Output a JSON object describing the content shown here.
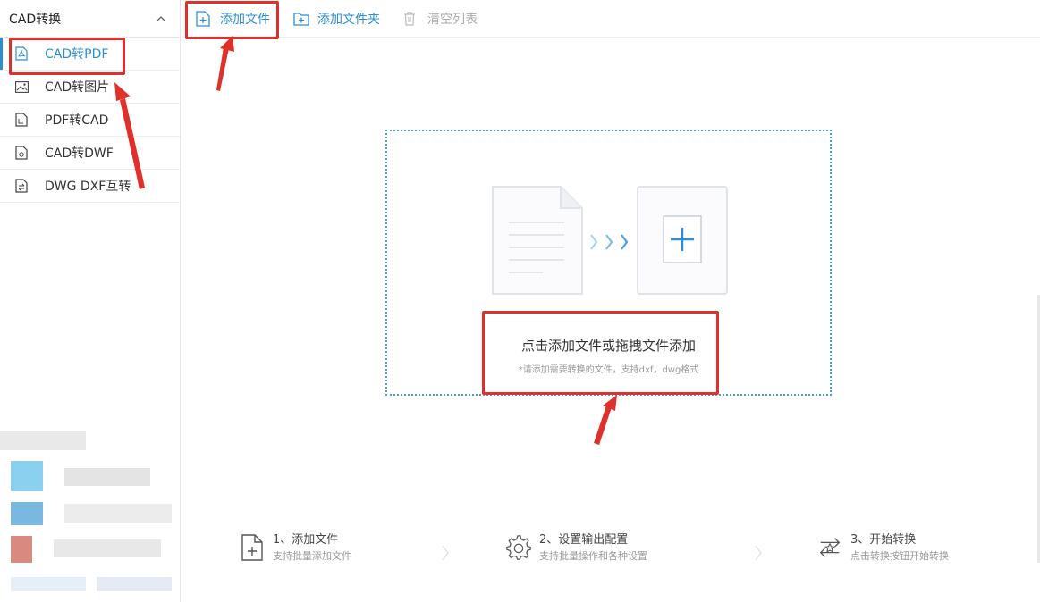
{
  "sidebar": {
    "header": "CAD转换",
    "items": [
      {
        "label": "CAD转PDF",
        "icon": "pdf-file-icon"
      },
      {
        "label": "CAD转图片",
        "icon": "image-icon"
      },
      {
        "label": "PDF转CAD",
        "icon": "document-icon"
      },
      {
        "label": "CAD转DWF",
        "icon": "document-icon"
      },
      {
        "label": "DWG DXF互转",
        "icon": "swap-document-icon"
      }
    ]
  },
  "toolbar": {
    "add_file": "添加文件",
    "add_folder": "添加文件夹",
    "clear_list": "清空列表"
  },
  "dropzone": {
    "main_text": "点击添加文件或拖拽文件添加",
    "sub_text": "*请添加需要转换的文件，支持dxf，dwg格式"
  },
  "steps": [
    {
      "title": "1、添加文件",
      "desc": "支持批量添加文件",
      "icon": "add-file-icon"
    },
    {
      "title": "2、设置输出配置",
      "desc": "支持批量操作和各种设置",
      "icon": "gear-icon"
    },
    {
      "title": "3、开始转换",
      "desc": "点击转换按钮开始转换",
      "icon": "convert-icon"
    }
  ],
  "colors": {
    "accent": "#2b8fd6",
    "annotation": "#e0302b",
    "dropzone_border": "#4b9ede"
  }
}
